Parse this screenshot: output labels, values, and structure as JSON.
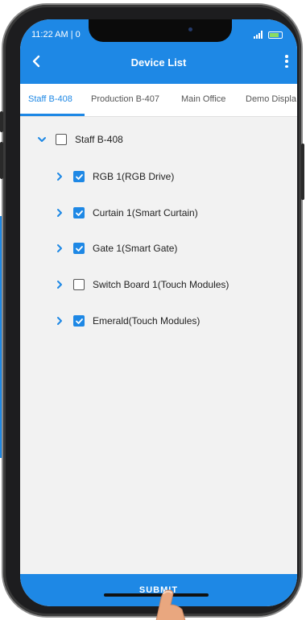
{
  "status_bar": {
    "time": "11:22 AM | 0"
  },
  "app_bar": {
    "title": "Device List",
    "back_icon": "back-arrow-icon",
    "menu_icon": "more-vert-icon"
  },
  "tabs": [
    {
      "label": "Staff B-408",
      "active": true
    },
    {
      "label": "Production B-407",
      "active": false
    },
    {
      "label": "Main Office",
      "active": false
    },
    {
      "label": "Demo Displa",
      "active": false
    }
  ],
  "tree": {
    "root": {
      "label": "Staff B-408",
      "checked": false,
      "expanded": true
    },
    "children": [
      {
        "label": "RGB 1(RGB Drive)",
        "checked": true
      },
      {
        "label": "Curtain 1(Smart Curtain)",
        "checked": true
      },
      {
        "label": "Gate 1(Smart Gate)",
        "checked": true
      },
      {
        "label": "Switch Board 1(Touch Modules)",
        "checked": false
      },
      {
        "label": "Emerald(Touch Modules)",
        "checked": true
      }
    ]
  },
  "submit": {
    "label": "SUBMIT"
  },
  "colors": {
    "accent": "#1e88e5",
    "background": "#f2f2f2"
  }
}
